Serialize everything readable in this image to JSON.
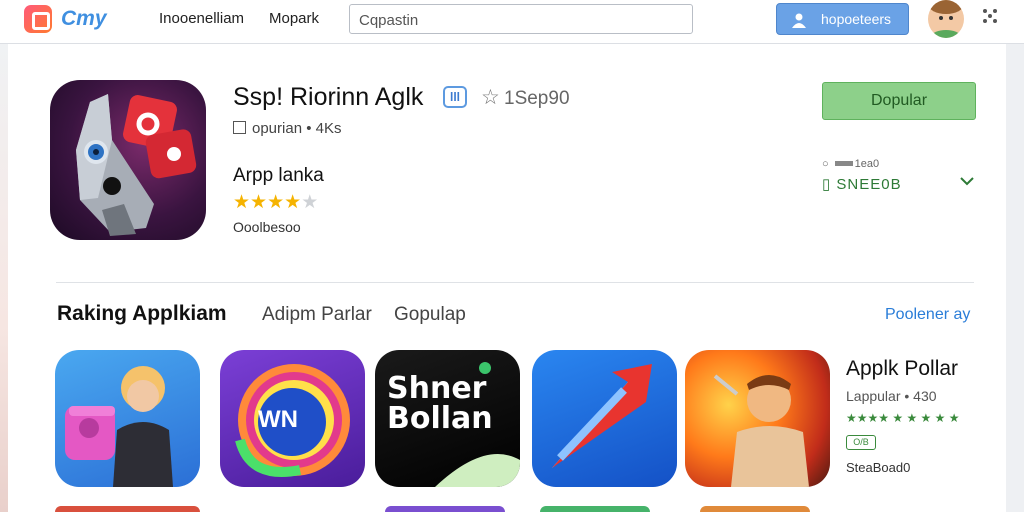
{
  "header": {
    "logo_text": "Cmy",
    "nav": [
      "Inooenelliam",
      "Mopark"
    ],
    "search_value": "Cqpastin",
    "user_button_label": "hopoeteers"
  },
  "app": {
    "title": "Ssp! Riorinn Aglk",
    "verified_label": "lll",
    "rating_count": "1Sep90",
    "meta": "opurian • 4Ks",
    "developer": "Arpp lanka",
    "rating": 3.5,
    "stars_total": 5,
    "sub_label": "Ooolbesoo",
    "install_label": "Dopular",
    "size_label": "1ea0",
    "status_label": "SNEE0B"
  },
  "section": {
    "title": "Raking Applkiam",
    "tabs": [
      "Adipm Parlar",
      "Gopulap"
    ],
    "see_all": "Poolener ay"
  },
  "cards": [
    {
      "name": "card-1"
    },
    {
      "name": "card-2",
      "text": "WN"
    },
    {
      "name": "card-3",
      "text": "Shner Bollan"
    },
    {
      "name": "card-4"
    },
    {
      "name": "card-5"
    }
  ],
  "featured": {
    "title": "Applk Pollar",
    "meta": "Lappular • 430",
    "rating_line": "★★★★ ★ ★ ★ ★ ★",
    "tag": "O/B",
    "sub": "SteaBoad0"
  },
  "colors": {
    "accent_blue": "#3f8fe0",
    "install_green": "#8dd08a",
    "star_gold": "#f5b301",
    "link_blue": "#2a7dd8"
  }
}
